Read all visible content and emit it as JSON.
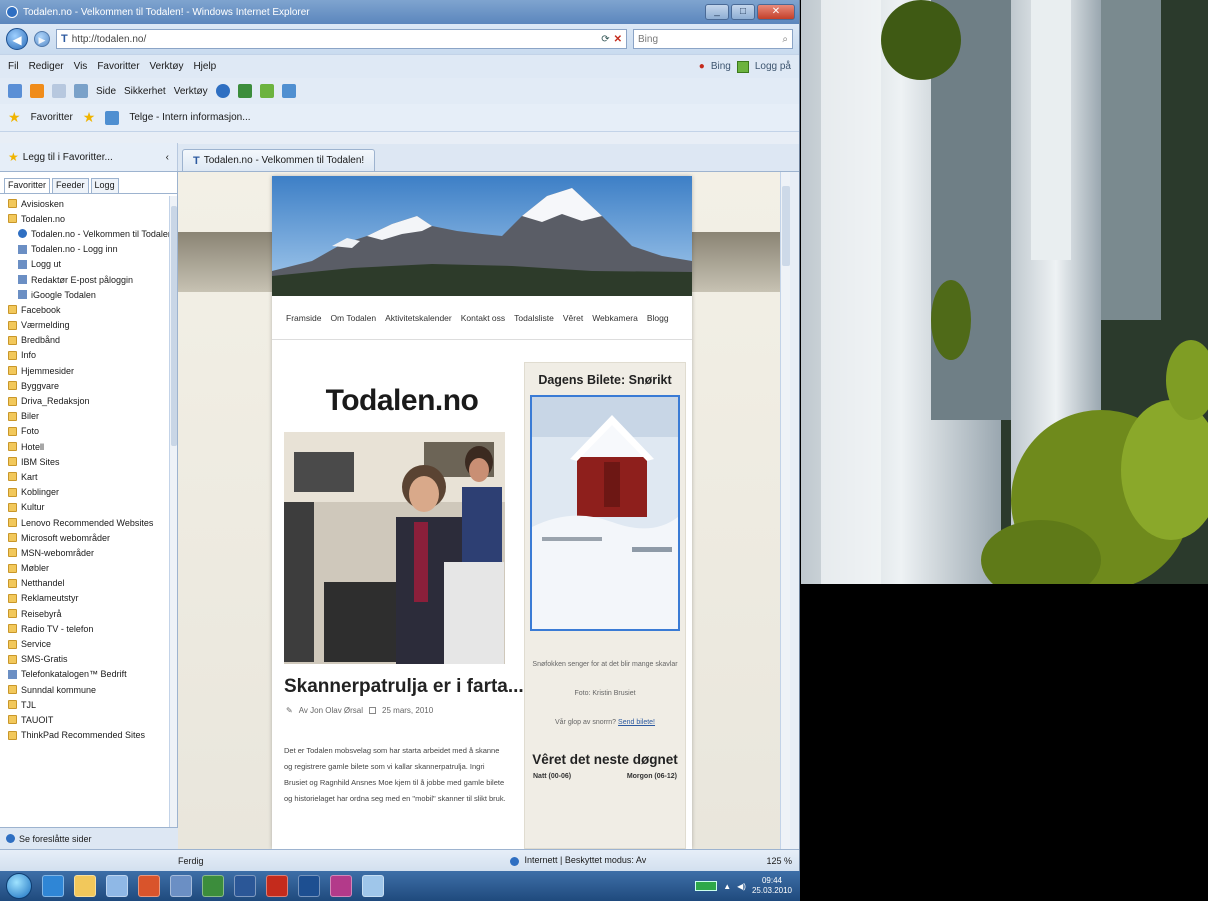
{
  "window": {
    "title": "Todalen.no - Velkommen til Todalen! - Windows Internet Explorer"
  },
  "address": {
    "url": "http://todalen.no/",
    "search_placeholder": "Bing"
  },
  "menubar": {
    "items": [
      "Fil",
      "Rediger",
      "Vis",
      "Favoritter",
      "Verktøy",
      "Hjelp"
    ],
    "bing_label": "Bing",
    "login_label": "Logg på"
  },
  "commandbar": {
    "items": [
      "Side",
      "Sikkerhet",
      "Verktøy"
    ]
  },
  "favbar": {
    "favorites_label": "Favoritter",
    "item": "Telge - Intern informasjon..."
  },
  "tabs": {
    "add_favorites": "Legg til i Favoritter...",
    "active_tab": "Todalen.no - Velkommen til Todalen!"
  },
  "favpane": {
    "tabs": [
      "Favoritter",
      "Feeder",
      "Logg"
    ],
    "items": [
      {
        "label": "Avisiosken",
        "type": "folder",
        "indent": false
      },
      {
        "label": "Todalen.no",
        "type": "folder",
        "indent": false
      },
      {
        "label": "Todalen.no - Velkommen til Todalen!",
        "type": "globe",
        "indent": true
      },
      {
        "label": "Todalen.no - Logg inn",
        "type": "page",
        "indent": true
      },
      {
        "label": "Logg ut",
        "type": "page",
        "indent": true
      },
      {
        "label": "Redaktør E-post påloggin",
        "type": "page",
        "indent": true
      },
      {
        "label": "iGoogle Todalen",
        "type": "page",
        "indent": true
      },
      {
        "label": "Facebook",
        "type": "folder",
        "indent": false
      },
      {
        "label": "Værmelding",
        "type": "folder",
        "indent": false
      },
      {
        "label": "Bredbånd",
        "type": "folder",
        "indent": false
      },
      {
        "label": "Info",
        "type": "folder",
        "indent": false
      },
      {
        "label": "Hjemmesider",
        "type": "folder",
        "indent": false
      },
      {
        "label": "Byggvare",
        "type": "folder",
        "indent": false
      },
      {
        "label": "Driva_Redaksjon",
        "type": "folder",
        "indent": false
      },
      {
        "label": "Biler",
        "type": "folder",
        "indent": false
      },
      {
        "label": "Foto",
        "type": "folder",
        "indent": false
      },
      {
        "label": "Hotell",
        "type": "folder",
        "indent": false
      },
      {
        "label": "IBM Sites",
        "type": "folder",
        "indent": false
      },
      {
        "label": "Kart",
        "type": "folder",
        "indent": false
      },
      {
        "label": "Koblinger",
        "type": "folder",
        "indent": false
      },
      {
        "label": "Kultur",
        "type": "folder",
        "indent": false
      },
      {
        "label": "Lenovo Recommended Websites",
        "type": "folder",
        "indent": false
      },
      {
        "label": "Microsoft webområder",
        "type": "folder",
        "indent": false
      },
      {
        "label": "MSN-webområder",
        "type": "folder",
        "indent": false
      },
      {
        "label": "Møbler",
        "type": "folder",
        "indent": false
      },
      {
        "label": "Netthandel",
        "type": "folder",
        "indent": false
      },
      {
        "label": "Reklameutstyr",
        "type": "folder",
        "indent": false
      },
      {
        "label": "Reisebyrå",
        "type": "folder",
        "indent": false
      },
      {
        "label": "Radio TV - telefon",
        "type": "folder",
        "indent": false
      },
      {
        "label": "Service",
        "type": "folder",
        "indent": false
      },
      {
        "label": "SMS-Gratis",
        "type": "folder",
        "indent": false
      },
      {
        "label": "Telefonkatalogen™ Bedrift",
        "type": "page",
        "indent": false
      },
      {
        "label": "Sunndal kommune",
        "type": "folder",
        "indent": false
      },
      {
        "label": "TJL",
        "type": "folder",
        "indent": false
      },
      {
        "label": "TAUOIT",
        "type": "folder",
        "indent": false
      },
      {
        "label": "ThinkPad Recommended Sites",
        "type": "folder",
        "indent": false
      }
    ],
    "see_more": "Se foreslåtte sider"
  },
  "site": {
    "nav": [
      "Framside",
      "Om Todalen",
      "Aktivitetskalender",
      "Kontakt oss",
      "Todalsliste",
      "Vêret",
      "Webkamera",
      "Blogg"
    ],
    "title": "Todalen.no",
    "post_title": "Skannerpatrulja er i farta...",
    "post_author": "Av Jon Olav Ørsal",
    "post_date": "25 mars, 2010",
    "post_body": "Det er Todalen mobsvelag som har starta arbeidet med å skanne og registrere gamle bilete som vi kallar skannerpatrulja. Ingri Brusiet og Ragnhild Ansnes Moe kjem til å jobbe med gamle bilete og historielaget har ordna seg med en \"mobil\" skanner til slikt bruk.",
    "side_head": "Dagens Bilete: Snørikt",
    "side_caption": "Snøfokken senger for at det blir mange skavlar",
    "side_photo_credit": "Foto: Kristin Brusiet",
    "side_question": "Vår glop av snorrn?",
    "side_link": "Send bilete!",
    "weather_head": "Vêret det neste døgnet",
    "weather_cols": [
      "Natt (00-06)",
      "Morgon (06-12)"
    ]
  },
  "status": {
    "ready": "Ferdig",
    "zone": "Internett | Beskyttet modus: Av",
    "zoom": "125 %"
  },
  "taskbar": {
    "time": "09:44",
    "date": "25.03.2010"
  },
  "colors": {
    "accent": "#2d5aa0",
    "taskbar": "#1f4a7d",
    "barn_red": "#8e1f1c"
  }
}
